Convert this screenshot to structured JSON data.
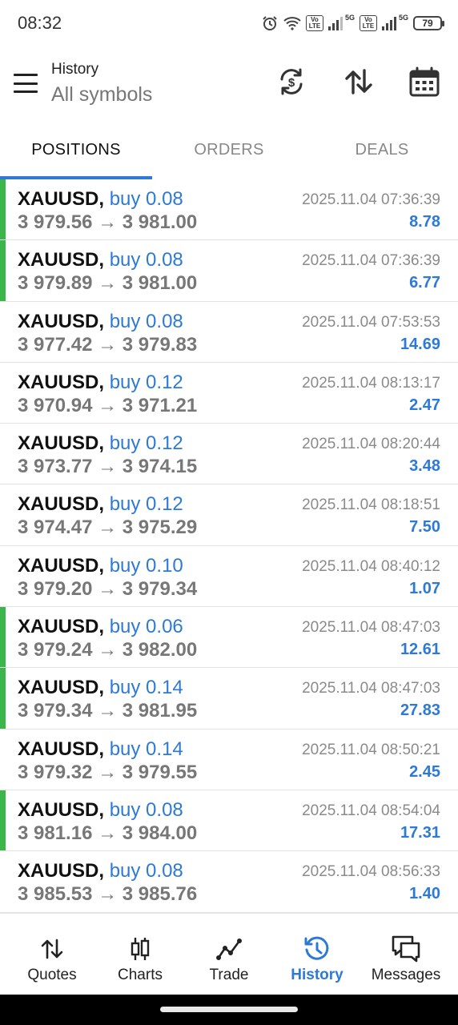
{
  "status_bar": {
    "time": "08:32",
    "battery": "79",
    "network_1": "5G",
    "network_2": "5G",
    "volte_1": "Vo LTE",
    "volte_2": "Vo LTE"
  },
  "toolbar": {
    "title": "History",
    "subtitle": "All symbols",
    "icons": [
      "menu-icon",
      "currency-sync-icon",
      "sort-icon",
      "calendar-icon"
    ]
  },
  "tabs": [
    {
      "label": "POSITIONS",
      "active": true
    },
    {
      "label": "ORDERS",
      "active": false
    },
    {
      "label": "DEALS",
      "active": false
    }
  ],
  "positions": [
    {
      "symbol": "XAUUSD,",
      "side": "buy 0.08",
      "prices": "3 979.56 → 3 981.00",
      "time": "2025.11.04 07:36:39",
      "profit": "8.78",
      "marked": true
    },
    {
      "symbol": "XAUUSD,",
      "side": "buy 0.08",
      "prices": "3 979.89 → 3 981.00",
      "time": "2025.11.04 07:36:39",
      "profit": "6.77",
      "marked": true
    },
    {
      "symbol": "XAUUSD,",
      "side": "buy 0.08",
      "prices": "3 977.42 → 3 979.83",
      "time": "2025.11.04 07:53:53",
      "profit": "14.69",
      "marked": false
    },
    {
      "symbol": "XAUUSD,",
      "side": "buy 0.12",
      "prices": "3 970.94 → 3 971.21",
      "time": "2025.11.04 08:13:17",
      "profit": "2.47",
      "marked": false
    },
    {
      "symbol": "XAUUSD,",
      "side": "buy 0.12",
      "prices": "3 973.77 → 3 974.15",
      "time": "2025.11.04 08:20:44",
      "profit": "3.48",
      "marked": false
    },
    {
      "symbol": "XAUUSD,",
      "side": "buy 0.12",
      "prices": "3 974.47 → 3 975.29",
      "time": "2025.11.04 08:18:51",
      "profit": "7.50",
      "marked": false
    },
    {
      "symbol": "XAUUSD,",
      "side": "buy 0.10",
      "prices": "3 979.20 → 3 979.34",
      "time": "2025.11.04 08:40:12",
      "profit": "1.07",
      "marked": false
    },
    {
      "symbol": "XAUUSD,",
      "side": "buy 0.06",
      "prices": "3 979.24 → 3 982.00",
      "time": "2025.11.04 08:47:03",
      "profit": "12.61",
      "marked": true
    },
    {
      "symbol": "XAUUSD,",
      "side": "buy 0.14",
      "prices": "3 979.34 → 3 981.95",
      "time": "2025.11.04 08:47:03",
      "profit": "27.83",
      "marked": true
    },
    {
      "symbol": "XAUUSD,",
      "side": "buy 0.14",
      "prices": "3 979.32 → 3 979.55",
      "time": "2025.11.04 08:50:21",
      "profit": "2.45",
      "marked": false
    },
    {
      "symbol": "XAUUSD,",
      "side": "buy 0.08",
      "prices": "3 981.16 → 3 984.00",
      "time": "2025.11.04 08:54:04",
      "profit": "17.31",
      "marked": true
    },
    {
      "symbol": "XAUUSD,",
      "side": "buy 0.08",
      "prices": "3 985.53 → 3 985.76",
      "time": "2025.11.04 08:56:33",
      "profit": "1.40",
      "marked": false
    }
  ],
  "bottom_nav": [
    {
      "label": "Quotes",
      "icon": "quotes-icon",
      "active": false
    },
    {
      "label": "Charts",
      "icon": "charts-icon",
      "active": false
    },
    {
      "label": "Trade",
      "icon": "trade-icon",
      "active": false
    },
    {
      "label": "History",
      "icon": "history-icon",
      "active": true
    },
    {
      "label": "Messages",
      "icon": "messages-icon",
      "active": false
    }
  ],
  "colors": {
    "accent": "#2d7ad6",
    "marker": "#3cb54a",
    "text_primary": "#111111",
    "text_secondary": "#777777"
  }
}
